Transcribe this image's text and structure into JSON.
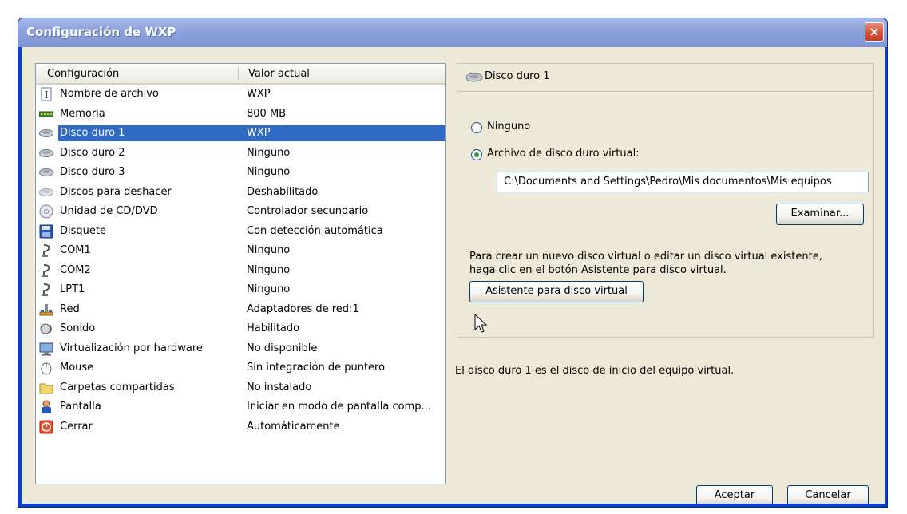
{
  "window": {
    "title": "Configuración de WXP",
    "close_glyph": "×"
  },
  "list": {
    "header": {
      "setting": "Configuración",
      "value": "Valor actual"
    },
    "rows": [
      {
        "icon": "file-name-icon",
        "label": "Nombre de archivo",
        "value": "WXP"
      },
      {
        "icon": "memory-icon",
        "label": "Memoria",
        "value": "800 MB"
      },
      {
        "icon": "hard-disk-icon",
        "label": "Disco duro 1",
        "value": "WXP",
        "selected": true
      },
      {
        "icon": "hard-disk-icon",
        "label": "Disco duro 2",
        "value": "Ninguno"
      },
      {
        "icon": "hard-disk-icon",
        "label": "Disco duro 3",
        "value": "Ninguno"
      },
      {
        "icon": "undo-disk-icon",
        "label": "Discos para deshacer",
        "value": "Deshabilitado"
      },
      {
        "icon": "cd-dvd-icon",
        "label": "Unidad de CD/DVD",
        "value": "Controlador secundario"
      },
      {
        "icon": "floppy-icon",
        "label": "Disquete",
        "value": "Con detección automática"
      },
      {
        "icon": "serial-port-icon",
        "label": "COM1",
        "value": "Ninguno"
      },
      {
        "icon": "serial-port-icon",
        "label": "COM2",
        "value": "Ninguno"
      },
      {
        "icon": "serial-port-icon",
        "label": "LPT1",
        "value": "Ninguno"
      },
      {
        "icon": "network-icon",
        "label": "Red",
        "value": "Adaptadores de red:1"
      },
      {
        "icon": "sound-icon",
        "label": "Sonido",
        "value": "Habilitado"
      },
      {
        "icon": "virtualization-icon",
        "label": "Virtualización por hardware",
        "value": "No disponible"
      },
      {
        "icon": "mouse-icon",
        "label": "Mouse",
        "value": "Sin integración de puntero"
      },
      {
        "icon": "folder-icon",
        "label": "Carpetas compartidas",
        "value": "No instalado"
      },
      {
        "icon": "display-icon",
        "label": "Pantalla",
        "value": "Iniciar en modo de pantalla comp..."
      },
      {
        "icon": "close-power-icon",
        "label": "Cerrar",
        "value": "Automáticamente"
      }
    ]
  },
  "detail": {
    "header": "Disco duro 1",
    "radio_none": "Ninguno",
    "radio_vhd": "Archivo de disco duro virtual:",
    "path": "C:\\Documents and Settings\\Pedro\\Mis documentos\\Mis equipos",
    "browse_button": "Examinar...",
    "info_line1": "Para crear un nuevo disco virtual o editar un disco virtual existente,",
    "info_line2": "haga clic en el botón Asistente para disco virtual.",
    "wizard_button": "Asistente para disco virtual",
    "boot_note": "El disco duro 1 es el disco de inicio del equipo virtual."
  },
  "footer": {
    "ok_button": "Aceptar",
    "cancel_button": "Cancelar"
  },
  "colors": {
    "selection": "#316ac5",
    "titlebar": "#8fa4dd",
    "dialog_bg": "#ece9d8",
    "close": "#d9523a"
  }
}
